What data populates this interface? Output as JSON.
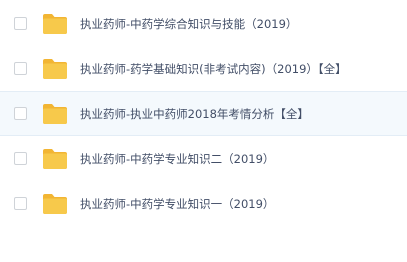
{
  "colors": {
    "folder": "#f7c94b",
    "folder_tab": "#f2b533",
    "text": "#424e67",
    "row_hover_bg": "#f4f9fd"
  },
  "files": [
    {
      "icon": "folder-icon",
      "name": "执业药师-中药学综合知识与技能（2019）"
    },
    {
      "icon": "folder-icon",
      "name": "执业药师-药学基础知识(非考试内容)（2019）【全】"
    },
    {
      "icon": "folder-icon",
      "name": "执业药师-执业中药师2018年考情分析【全】"
    },
    {
      "icon": "folder-icon",
      "name": "执业药师-中药学专业知识二（2019）"
    },
    {
      "icon": "folder-icon",
      "name": "执业药师-中药学专业知识一（2019）"
    }
  ]
}
